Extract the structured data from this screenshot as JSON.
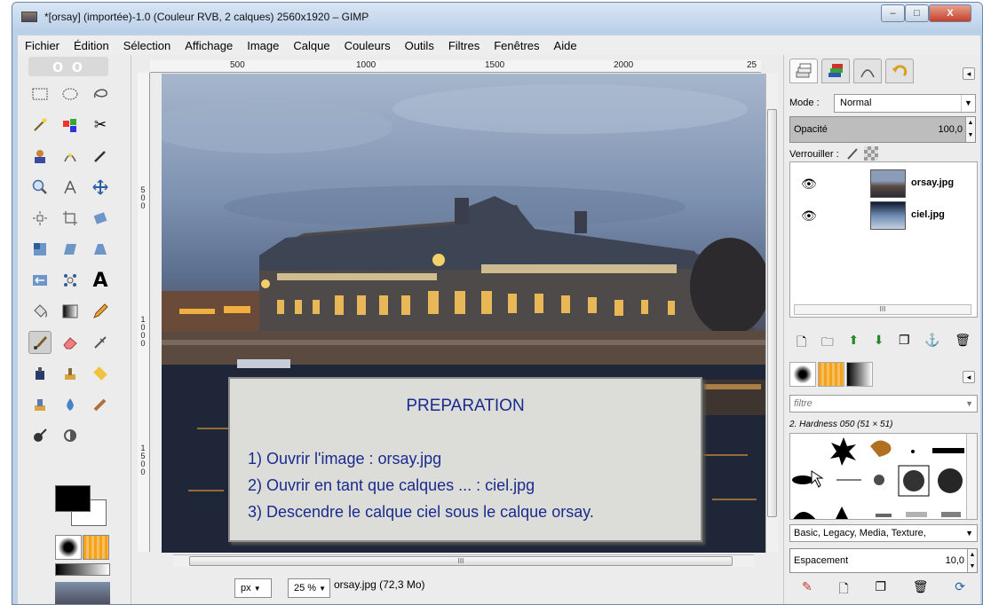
{
  "window": {
    "title": "*[orsay] (importée)-1.0 (Couleur RVB, 2 calques) 2560x1920 – GIMP",
    "minimize": "–",
    "maximize": "□",
    "close": "X"
  },
  "menu": [
    {
      "label": "Fichier"
    },
    {
      "label": "Édition"
    },
    {
      "label": "Sélection"
    },
    {
      "label": "Affichage"
    },
    {
      "label": "Image"
    },
    {
      "label": "Calque"
    },
    {
      "label": "Couleurs"
    },
    {
      "label": "Outils"
    },
    {
      "label": "Filtres"
    },
    {
      "label": "Fenêtres"
    },
    {
      "label": "Aide"
    }
  ],
  "ruler": {
    "h_labels": [
      "500",
      "1000",
      "1500",
      "2000",
      "25"
    ],
    "v_labels": [
      "5\n0\n0",
      "1\n0\n0\n0",
      "1\n5\n0\n0"
    ]
  },
  "status": {
    "unit": "px",
    "zoom": "25 %",
    "file_info": "orsay.jpg (72,3 Mo)",
    "hscroll_grip": "III"
  },
  "instructions": {
    "title": "PREPARATION",
    "steps": [
      "1)  Ouvrir l'image : orsay.jpg",
      "2)  Ouvrir en tant que calques ... : ciel.jpg",
      "3)  Descendre le calque ciel sous le calque orsay."
    ]
  },
  "layers_panel": {
    "mode_label": "Mode :",
    "mode_value": "Normal",
    "opacity_label": "Opacité",
    "opacity_value": "100,0",
    "lock_label": "Verrouiller :",
    "layers": [
      {
        "name": "orsay.jpg"
      },
      {
        "name": "ciel.jpg"
      }
    ],
    "scroll_grip": "III"
  },
  "brushes_panel": {
    "filter_placeholder": "filtre",
    "brush_name": "2. Hardness 050 (51 × 51)",
    "tags": "Basic, Legacy, Media, Texture,",
    "spacing_label": "Espacement",
    "spacing_value": "10,0"
  },
  "colors": {
    "accent_text": "#1a2b8f",
    "foreground": "#000000",
    "background": "#ffffff"
  }
}
